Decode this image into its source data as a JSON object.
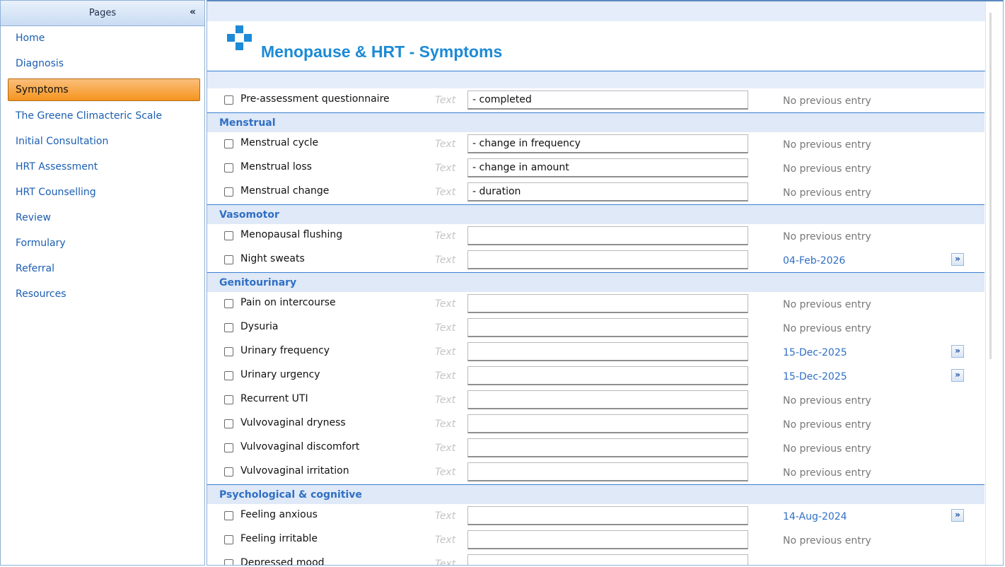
{
  "sidebar": {
    "title": "Pages",
    "collapse_icon": "«",
    "items": [
      {
        "label": "Home",
        "active": false
      },
      {
        "label": "Diagnosis",
        "active": false
      },
      {
        "label": "Symptoms",
        "active": true
      },
      {
        "label": "The Greene Climacteric Scale",
        "active": false
      },
      {
        "label": "Initial Consultation",
        "active": false
      },
      {
        "label": "HRT Assessment",
        "active": false
      },
      {
        "label": "HRT Counselling",
        "active": false
      },
      {
        "label": "Review",
        "active": false
      },
      {
        "label": "Formulary",
        "active": false
      },
      {
        "label": "Referral",
        "active": false
      },
      {
        "label": "Resources",
        "active": false
      }
    ]
  },
  "page": {
    "title": "Menopause & HRT - Symptoms",
    "logo": "medical-cross-icon",
    "accent_color": "#1c8ad6"
  },
  "text_placeholder_label": "Text",
  "go_button_glyph": "»",
  "top_rows": [
    {
      "label": "Pre-assessment questionnaire",
      "value": "- completed",
      "previous": "No previous entry",
      "has_go": false
    }
  ],
  "sections": [
    {
      "name": "Menstrual",
      "rows": [
        {
          "label": "Menstrual cycle",
          "value": "- change in frequency",
          "previous": "No previous entry",
          "has_go": false
        },
        {
          "label": "Menstrual loss",
          "value": "- change in amount",
          "previous": "No previous entry",
          "has_go": false
        },
        {
          "label": "Menstrual change",
          "value": "- duration",
          "previous": "No previous entry",
          "has_go": false
        }
      ]
    },
    {
      "name": "Vasomotor",
      "rows": [
        {
          "label": "Menopausal flushing",
          "value": "",
          "previous": "No previous entry",
          "has_go": false
        },
        {
          "label": "Night sweats",
          "value": "",
          "previous": "04-Feb-2026",
          "has_go": true
        }
      ]
    },
    {
      "name": "Genitourinary",
      "rows": [
        {
          "label": "Pain on intercourse",
          "value": "",
          "previous": "No previous entry",
          "has_go": false
        },
        {
          "label": "Dysuria",
          "value": "",
          "previous": "No previous entry",
          "has_go": false
        },
        {
          "label": "Urinary frequency",
          "value": "",
          "previous": "15-Dec-2025",
          "has_go": true
        },
        {
          "label": "Urinary urgency",
          "value": "",
          "previous": "15-Dec-2025",
          "has_go": true
        },
        {
          "label": "Recurrent UTI",
          "value": "",
          "previous": "No previous entry",
          "has_go": false
        },
        {
          "label": "Vulvovaginal dryness",
          "value": "",
          "previous": "No previous entry",
          "has_go": false
        },
        {
          "label": "Vulvovaginal discomfort",
          "value": "",
          "previous": "No previous entry",
          "has_go": false
        },
        {
          "label": "Vulvovaginal irritation",
          "value": "",
          "previous": "No previous entry",
          "has_go": false
        }
      ]
    },
    {
      "name": "Psychological & cognitive",
      "rows": [
        {
          "label": "Feeling anxious",
          "value": "",
          "previous": "14-Aug-2024",
          "has_go": true
        },
        {
          "label": "Feeling irritable",
          "value": "",
          "previous": "No previous entry",
          "has_go": false
        },
        {
          "label": "Depressed mood",
          "value": "",
          "previous": "",
          "has_go": false
        }
      ]
    }
  ]
}
